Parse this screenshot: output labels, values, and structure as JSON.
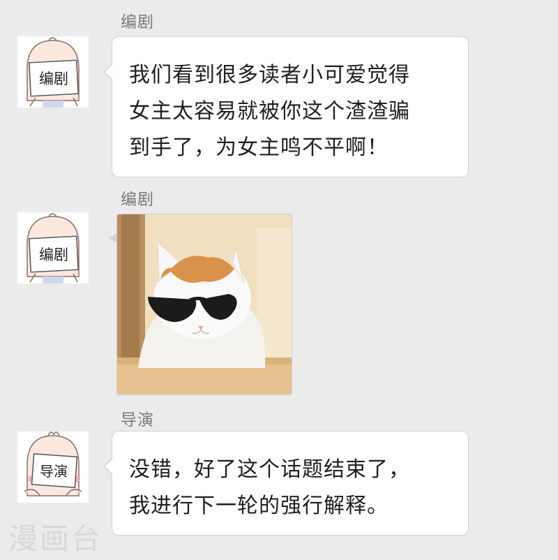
{
  "messages": [
    {
      "sender": "编剧",
      "avatar_label": "编剧",
      "text_lines": [
        "我们看到很多读者小可爱觉得",
        "女主太容易就被你这个渣渣骗",
        "到手了，为女主鸣不平啊！"
      ]
    },
    {
      "sender": "编剧",
      "avatar_label": "编剧",
      "image": "cat-with-sunglasses"
    },
    {
      "sender": "导演",
      "avatar_label": "导演",
      "text_lines": [
        "没错，好了这个话题结束了，",
        "我进行下一轮的强行解释。"
      ]
    }
  ],
  "watermark": "漫画台",
  "colors": {
    "background": "#ebebeb",
    "bubble": "#ffffff",
    "sender_name": "#7a7a7a",
    "message_text": "#1e1e1e",
    "watermark": "#d8d8d8"
  }
}
